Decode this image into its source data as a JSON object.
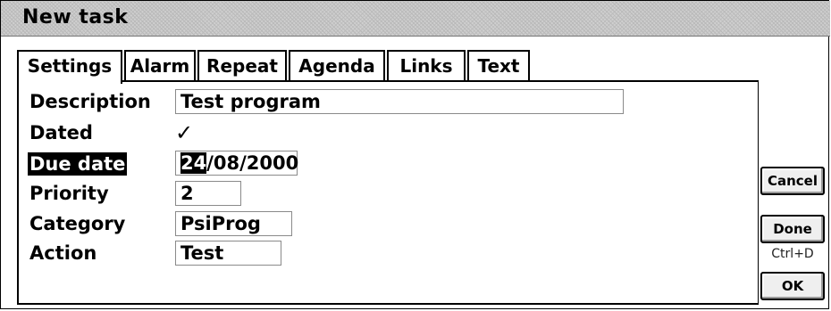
{
  "window": {
    "title": "New task"
  },
  "tabs": [
    {
      "label": "Settings",
      "active": true
    },
    {
      "label": "Alarm"
    },
    {
      "label": "Repeat"
    },
    {
      "label": "Agenda"
    },
    {
      "label": "Links"
    },
    {
      "label": "Text"
    }
  ],
  "fields": {
    "description": {
      "label": "Description",
      "value": "Test program"
    },
    "dated": {
      "label": "Dated",
      "value": "✓"
    },
    "due_date": {
      "label": "Due date",
      "value_day": "24",
      "value_rest": "/08/2000"
    },
    "priority": {
      "label": "Priority",
      "value": "2"
    },
    "category": {
      "label": "Category",
      "value": "PsiProg"
    },
    "action": {
      "label": "Action",
      "value": "Test"
    }
  },
  "buttons": {
    "cancel": "Cancel",
    "done": "Done",
    "done_shortcut": "Ctrl+D",
    "ok": "OK"
  }
}
